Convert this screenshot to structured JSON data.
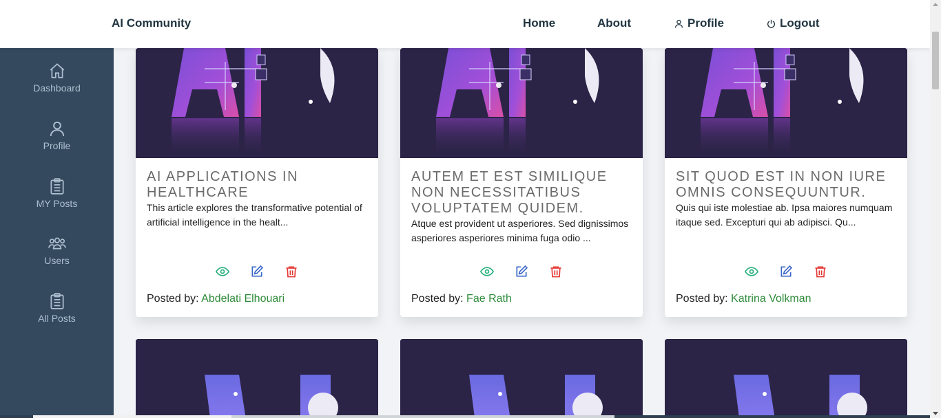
{
  "header": {
    "brand": "AI Community",
    "nav": {
      "home": "Home",
      "about": "About",
      "profile": "Profile",
      "logout": "Logout"
    }
  },
  "sidebar": {
    "items": [
      {
        "label": "Dashboard",
        "icon": "home-icon"
      },
      {
        "label": "Profile",
        "icon": "user-icon"
      },
      {
        "label": "MY Posts",
        "icon": "clipboard-icon"
      },
      {
        "label": "Users",
        "icon": "users-icon"
      },
      {
        "label": "All Posts",
        "icon": "clipboard-icon"
      }
    ]
  },
  "posts": [
    {
      "title": "AI APPLICATIONS IN HEALTHCARE",
      "description": "This article explores the transformative potential of artificial intelligence in the healt...",
      "posted_by_label": "Posted by: ",
      "author": "Abdelati Elhouari"
    },
    {
      "title": "AUTEM ET EST SIMILIQUE NON NECESSITATIBUS VOLUPTATEM QUIDEM.",
      "description": "Atque est provident ut asperiores. Sed dignissimos asperiores asperiores minima fuga odio ...",
      "posted_by_label": "Posted by: ",
      "author": "Fae Rath"
    },
    {
      "title": "SIT QUOD EST IN NON IURE OMNIS CONSEQUUNTUR.",
      "description": "Quis qui iste molestiae ab. Ipsa maiores numquam itaque sed. Excepturi qui ab adipisci. Qu...",
      "posted_by_label": "Posted by: ",
      "author": "Katrina Volkman"
    }
  ],
  "colors": {
    "view": "#2bb07f",
    "edit": "#3a66c8",
    "delete": "#e53935",
    "author": "#2e8b3a",
    "sidebar": "#34495e",
    "image_bg": "#2b2447"
  }
}
